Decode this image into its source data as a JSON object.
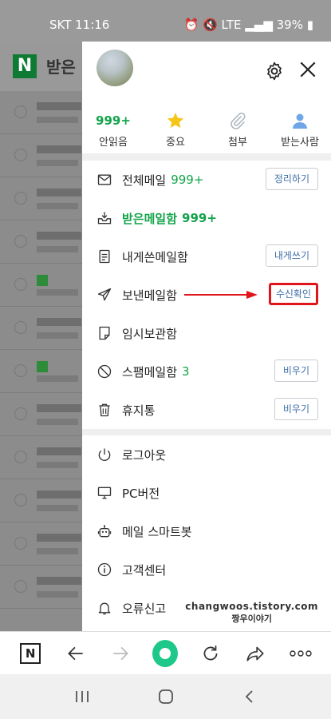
{
  "status": {
    "carrier_time": "SKT 11:16",
    "right": "⏰ 🔇 LTE ▂▄▆ 39% ▮"
  },
  "background": {
    "title": "받은"
  },
  "quick": [
    {
      "num": "999+",
      "label": "안읽음"
    },
    {
      "icon": "star-icon",
      "label": "중요"
    },
    {
      "icon": "paperclip-icon",
      "label": "첨부"
    },
    {
      "icon": "person-icon",
      "label": "받는사람"
    }
  ],
  "menu": [
    {
      "label": "전체메일",
      "count": "999+",
      "button": "정리하기"
    },
    {
      "label": "받은메일함",
      "count": "999+"
    },
    {
      "label": "내게쓴메일함",
      "button": "내게쓰기"
    },
    {
      "label": "보낸메일함",
      "button": "수신확인"
    },
    {
      "label": "임시보관함"
    },
    {
      "label": "스팸메일함",
      "count": "3",
      "button": "비우기"
    },
    {
      "label": "휴지통",
      "button": "비우기"
    }
  ],
  "menu2": [
    {
      "label": "로그아웃"
    },
    {
      "label": "PC버전"
    },
    {
      "label": "메일 스마트봇"
    },
    {
      "label": "고객센터"
    },
    {
      "label": "오류신고"
    }
  ],
  "watermark": {
    "url": "changwoos.tistory.com",
    "name": "짱우이야기"
  },
  "browser": {
    "logo": "N"
  },
  "colors": {
    "accent": "#12a44a",
    "highlight": "#e0151b",
    "link": "#3f6ea8"
  }
}
